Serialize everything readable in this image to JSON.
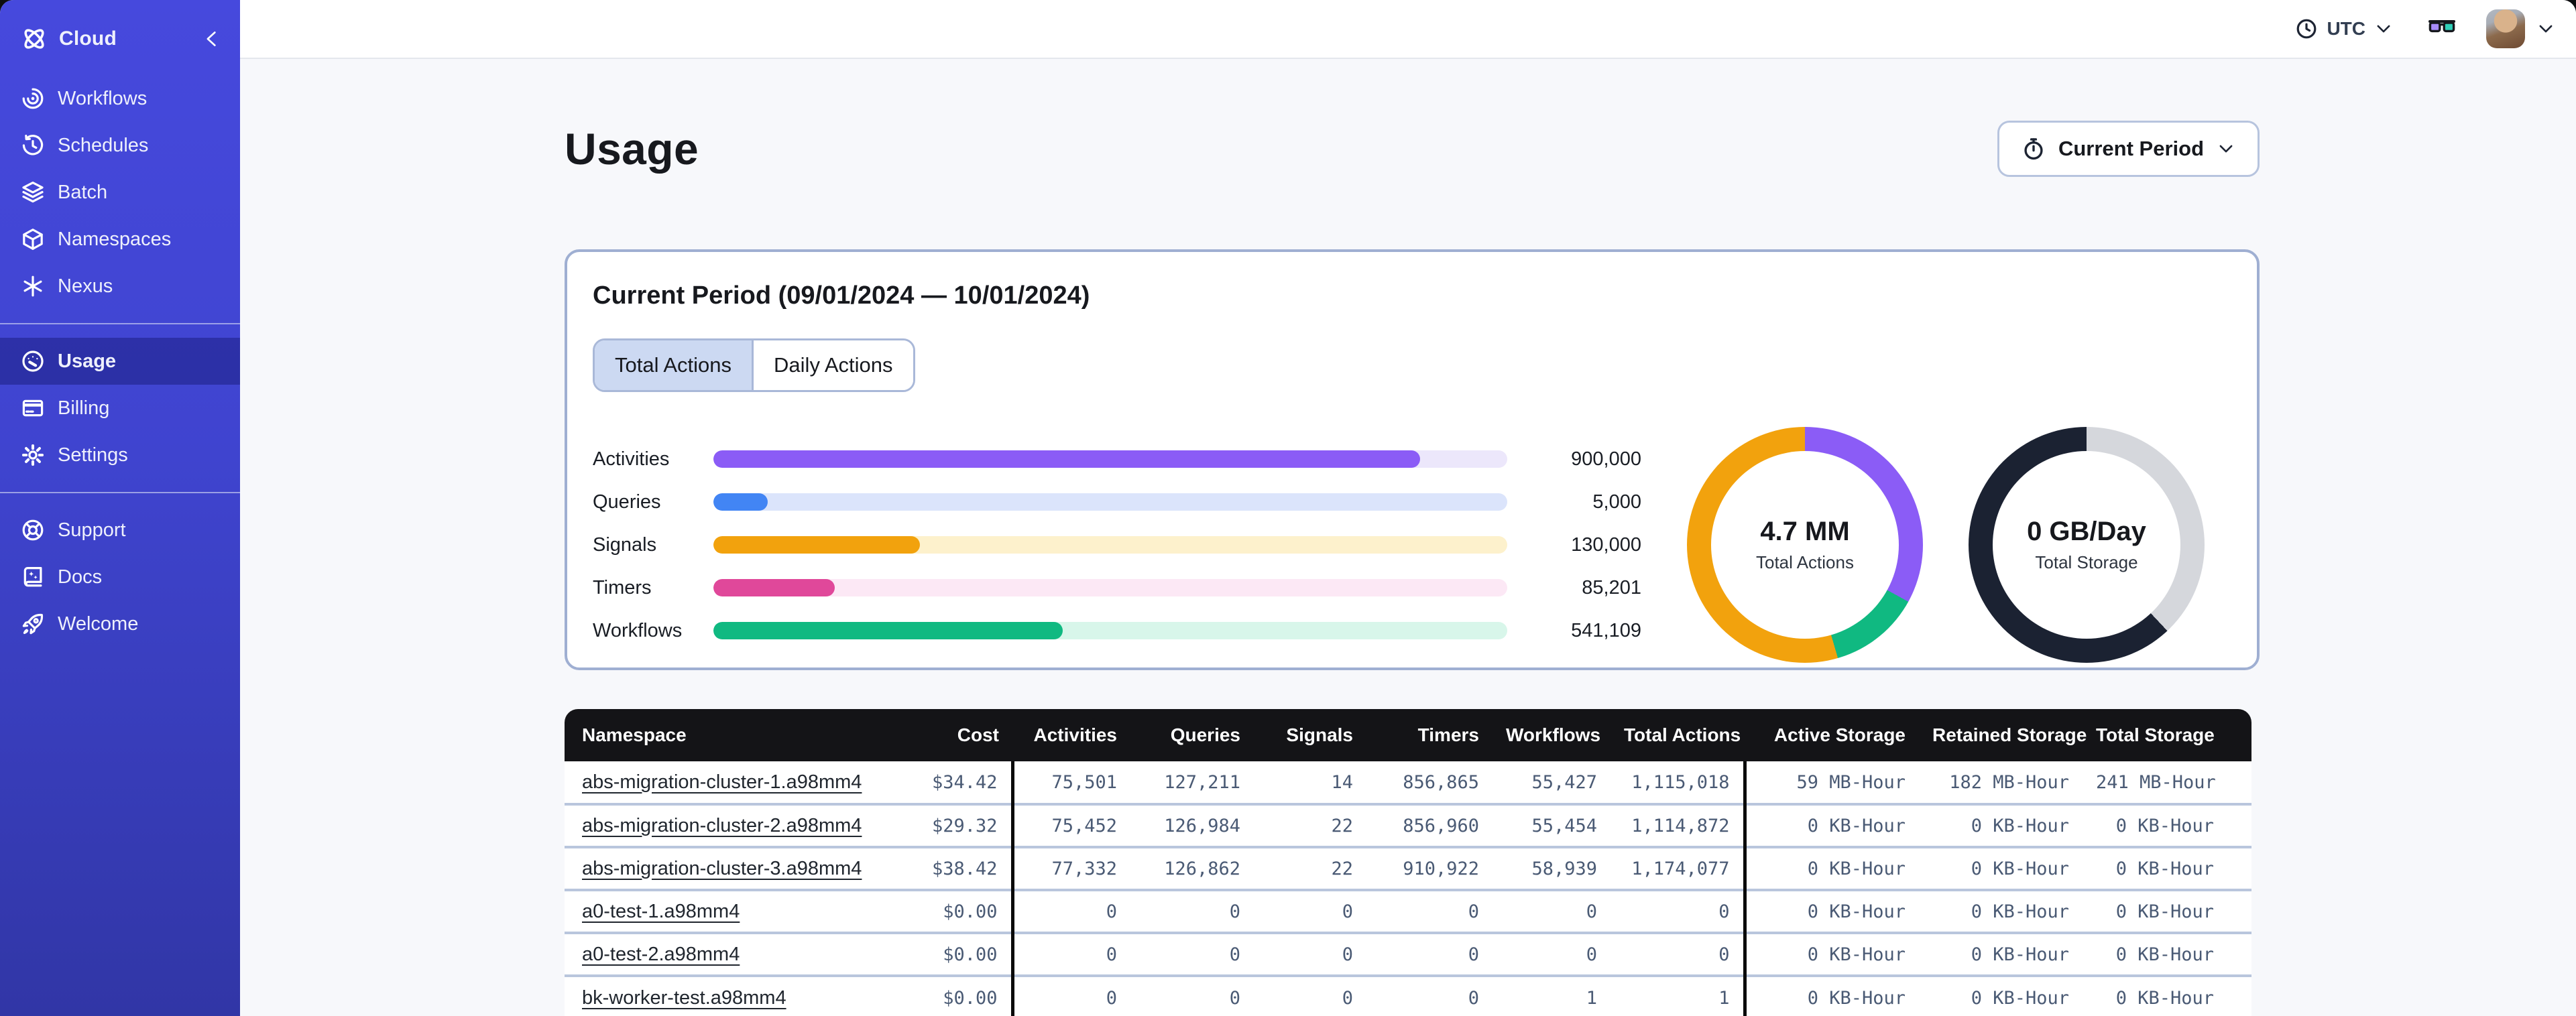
{
  "colors": {
    "sidebar_top": "#4649dd",
    "sidebar_bottom": "#3136a6",
    "sidebar_active": "#30349e",
    "panel_border": "#9fafd2",
    "tab_active_bg": "#ccd9f2",
    "table_header_bg": "#141417",
    "row_divider": "#b9c6dd",
    "accent_purple": "#8b5cf6",
    "accent_blue": "#4285f4",
    "accent_orange": "#f2a20d",
    "accent_pink": "#e0489a",
    "accent_green": "#10b981",
    "donut_navy": "#1b2232",
    "donut_gray": "#d5d7dc"
  },
  "sidebar": {
    "brand": {
      "label": "Cloud",
      "icon": "temporal-logo-icon",
      "collapse_icon": "chevron-left-icon"
    },
    "nav_main": [
      {
        "label": "Workflows",
        "icon": "workflows-spiral-icon"
      },
      {
        "label": "Schedules",
        "icon": "schedules-clock-icon"
      },
      {
        "label": "Batch",
        "icon": "batch-layers-icon"
      },
      {
        "label": "Namespaces",
        "icon": "namespaces-cube-icon"
      },
      {
        "label": "Nexus",
        "icon": "nexus-asterisk-icon"
      }
    ],
    "nav_account": [
      {
        "label": "Usage",
        "icon": "usage-gauge-icon",
        "active": true
      },
      {
        "label": "Billing",
        "icon": "billing-card-icon"
      },
      {
        "label": "Settings",
        "icon": "settings-gear-icon"
      }
    ],
    "nav_footer": [
      {
        "label": "Support",
        "icon": "support-lifebuoy-icon"
      },
      {
        "label": "Docs",
        "icon": "docs-book-icon"
      },
      {
        "label": "Welcome",
        "icon": "welcome-rocket-icon"
      }
    ]
  },
  "topbar": {
    "timezone_label": "UTC",
    "icons": [
      "clock-icon",
      "chevron-down-icon",
      "glasses-icon",
      "avatar",
      "chevron-down-icon"
    ]
  },
  "page": {
    "title": "Usage",
    "period_button_label": "Current Period",
    "period_button_icon": "stopwatch-icon"
  },
  "panel": {
    "title": "Current Period (09/01/2024 — 10/01/2024)",
    "tabs": [
      {
        "label": "Total Actions",
        "active": true
      },
      {
        "label": "Daily Actions",
        "active": false
      }
    ]
  },
  "chart_data": [
    {
      "type": "bar",
      "orientation": "horizontal",
      "categories": [
        "Activities",
        "Queries",
        "Signals",
        "Timers",
        "Workflows"
      ],
      "values": [
        900000,
        5000,
        130000,
        85201,
        541109
      ],
      "display_values": [
        "900,000",
        "5,000",
        "130,000",
        "85,201",
        "541,109"
      ],
      "fill_pct": [
        89,
        6.8,
        26,
        15.3,
        44
      ],
      "colors": [
        "#8b5cf6",
        "#4285f4",
        "#f2a20d",
        "#e0489a",
        "#10b981"
      ],
      "track_colors": [
        "#ece7fb",
        "#dbe4fb",
        "#fdf1cc",
        "#fce8f5",
        "#d8f6ea"
      ],
      "title": "",
      "xlabel": "",
      "ylabel": "",
      "grid": false,
      "legend": "none"
    },
    {
      "type": "pie",
      "subtype": "donut",
      "center_value": "4.7 MM",
      "center_label": "Total Actions",
      "segments": [
        {
          "color": "#8b5cf6",
          "pct": 33
        },
        {
          "color": "#10b981",
          "pct": 12.5
        },
        {
          "color": "#f2a20d",
          "pct": 54.5
        }
      ]
    },
    {
      "type": "pie",
      "subtype": "donut",
      "center_value": "0 GB/Day",
      "center_label": "Total Storage",
      "segments": [
        {
          "color": "#d5d7dc",
          "pct": 38
        },
        {
          "color": "#1b2232",
          "pct": 62
        }
      ]
    }
  ],
  "table": {
    "headers": [
      "Namespace",
      "Cost",
      "Activities",
      "Queries",
      "Signals",
      "Timers",
      "Workflows",
      "Total Actions",
      "Active Storage",
      "Retained Storage",
      "Total Storage"
    ],
    "rows": [
      [
        "abs-migration-cluster-1.a98mm4",
        "$34.42",
        "75,501",
        "127,211",
        "14",
        "856,865",
        "55,427",
        "1,115,018",
        "59 MB-Hour",
        "182 MB-Hour",
        "241 MB-Hour"
      ],
      [
        "abs-migration-cluster-2.a98mm4",
        "$29.32",
        "75,452",
        "126,984",
        "22",
        "856,960",
        "55,454",
        "1,114,872",
        "0 KB-Hour",
        "0 KB-Hour",
        "0 KB-Hour"
      ],
      [
        "abs-migration-cluster-3.a98mm4",
        "$38.42",
        "77,332",
        "126,862",
        "22",
        "910,922",
        "58,939",
        "1,174,077",
        "0 KB-Hour",
        "0 KB-Hour",
        "0 KB-Hour"
      ],
      [
        "a0-test-1.a98mm4",
        "$0.00",
        "0",
        "0",
        "0",
        "0",
        "0",
        "0",
        "0 KB-Hour",
        "0 KB-Hour",
        "0 KB-Hour"
      ],
      [
        "a0-test-2.a98mm4",
        "$0.00",
        "0",
        "0",
        "0",
        "0",
        "0",
        "0",
        "0 KB-Hour",
        "0 KB-Hour",
        "0 KB-Hour"
      ],
      [
        "bk-worker-test.a98mm4",
        "$0.00",
        "0",
        "0",
        "0",
        "0",
        "1",
        "1",
        "0 KB-Hour",
        "0 KB-Hour",
        "0 KB-Hour"
      ]
    ]
  }
}
